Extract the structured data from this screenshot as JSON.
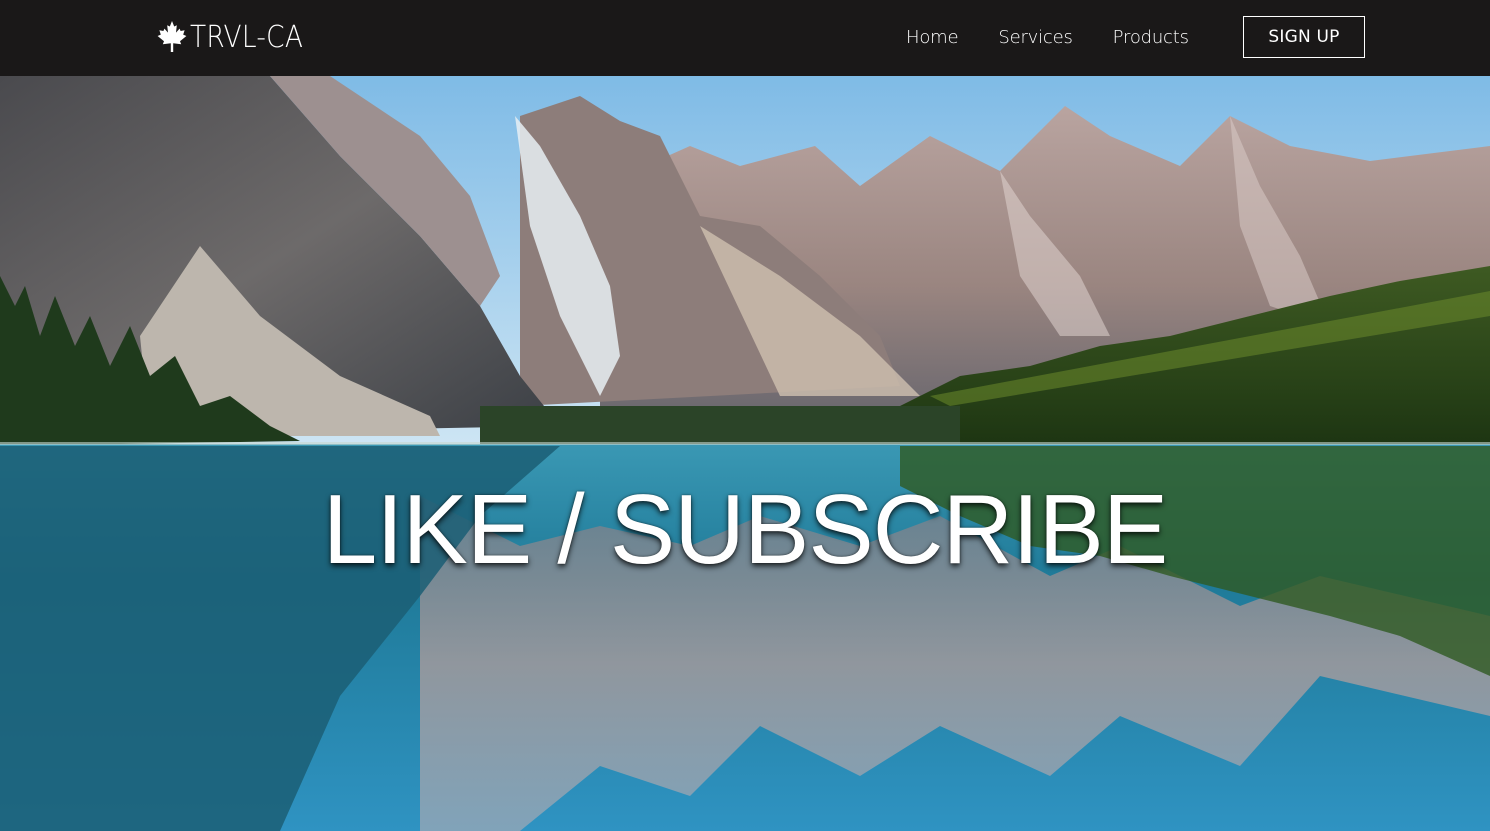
{
  "brand": {
    "name": "TRVL-CA",
    "icon": "maple-leaf-icon"
  },
  "nav": {
    "links": [
      {
        "label": "Home"
      },
      {
        "label": "Services"
      },
      {
        "label": "Products"
      }
    ],
    "signup_label": "SIGN UP"
  },
  "hero": {
    "headline": "LIKE / SUBSCRIBE",
    "image": "mountain-lake-reflection"
  },
  "colors": {
    "navbar": "#1a1818",
    "text": "#ffffff",
    "sky": "#8cc6ea",
    "lake": "#2a8aa8"
  }
}
